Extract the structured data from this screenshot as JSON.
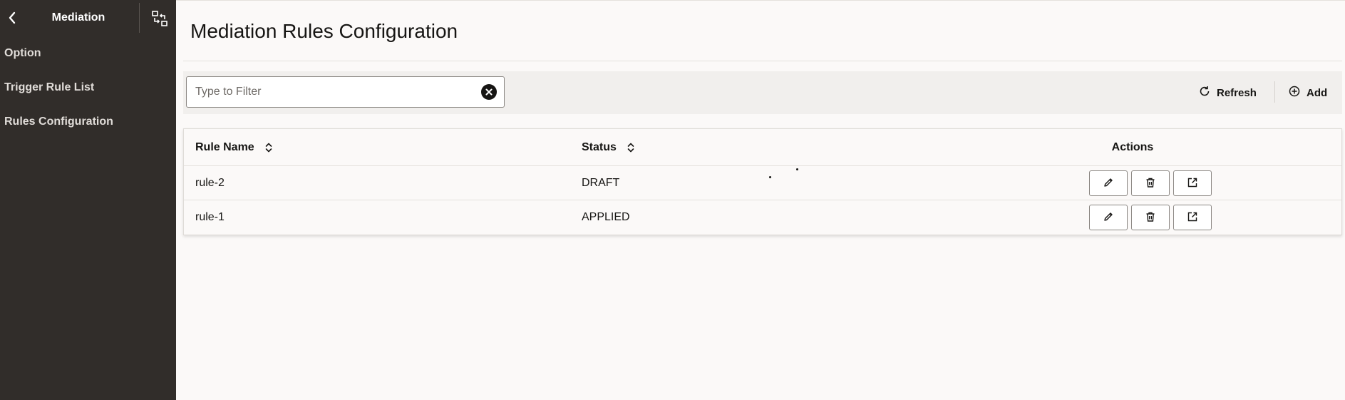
{
  "sidebar": {
    "title": "Mediation",
    "back_icon": "chevron-left-icon",
    "switch_icon": "switch-view-icon",
    "items": [
      {
        "label": "Option"
      },
      {
        "label": "Trigger Rule List"
      },
      {
        "label": "Rules Configuration"
      }
    ]
  },
  "main": {
    "title": "Mediation Rules Configuration"
  },
  "toolbar": {
    "filter_placeholder": "Type to Filter",
    "filter_value": "",
    "refresh_label": "Refresh",
    "add_label": "Add"
  },
  "table": {
    "headers": {
      "name": "Rule Name",
      "status": "Status",
      "actions": "Actions"
    },
    "rows": [
      {
        "name": "rule-2",
        "status": "DRAFT"
      },
      {
        "name": "rule-1",
        "status": "APPLIED"
      }
    ],
    "row_actions": [
      "edit-icon",
      "delete-icon",
      "open-external-icon"
    ]
  },
  "colors": {
    "sidebar_bg": "#312d2a",
    "page_bg": "#fbf9f8",
    "toolbar_bg": "#f1efed",
    "text": "#161513"
  }
}
